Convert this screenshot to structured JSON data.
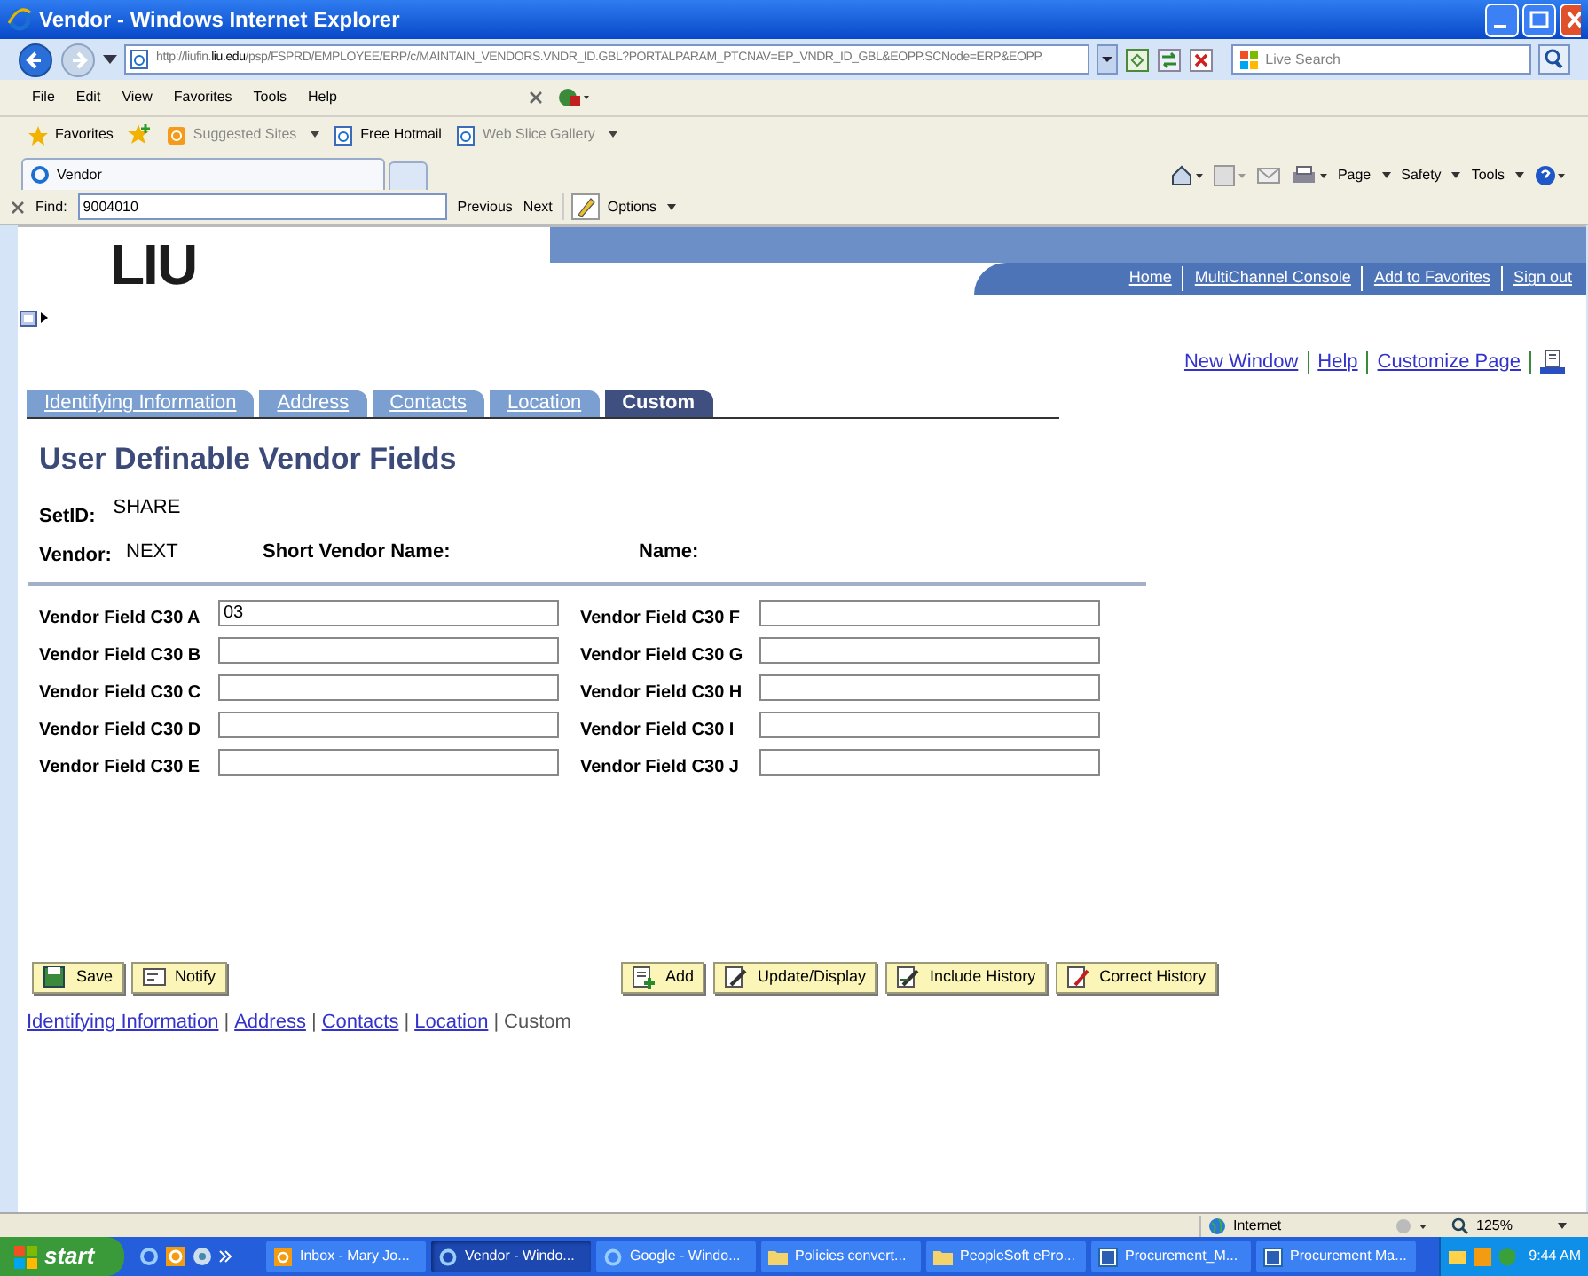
{
  "window": {
    "title": "Vendor - Windows Internet Explorer"
  },
  "address_bar": {
    "url_host": "http://liufin.",
    "url_domain": "liu.edu",
    "url_path": "/psp/FSPRD/EMPLOYEE/ERP/c/MAINTAIN_VENDORS.VNDR_ID.GBL?PORTALPARAM_PTCNAV=EP_VNDR_ID_GBL&EOPP.SCNode=ERP&EOPP."
  },
  "search": {
    "placeholder": "Live Search"
  },
  "menu": [
    "File",
    "Edit",
    "View",
    "Favorites",
    "Tools",
    "Help"
  ],
  "favorites_bar": {
    "favorites": "Favorites",
    "links": [
      "Suggested Sites",
      "Free Hotmail",
      "Web Slice Gallery"
    ]
  },
  "browser_tab": {
    "label": "Vendor"
  },
  "command_bar": [
    "Page",
    "Safety",
    "Tools"
  ],
  "find_bar": {
    "label": "Find:",
    "value": "9004010",
    "buttons": [
      "Previous",
      "Next"
    ],
    "options": "Options"
  },
  "page": {
    "logo": "LIU",
    "header_links": [
      "Home",
      "MultiChannel Console",
      "Add to Favorites",
      "Sign out"
    ],
    "page_links": [
      "New Window",
      "Help",
      "Customize Page"
    ],
    "tabs": [
      {
        "label": "Identifying Information",
        "selected": false
      },
      {
        "label": "Address",
        "selected": false
      },
      {
        "label": "Contacts",
        "selected": false
      },
      {
        "label": "Location",
        "selected": false
      },
      {
        "label": "Custom",
        "selected": true
      }
    ],
    "heading": "User Definable Vendor Fields",
    "setid": {
      "label": "SetID:",
      "value": "SHARE"
    },
    "vendor": {
      "label": "Vendor:",
      "value": "NEXT"
    },
    "short_vendor_name": {
      "label": "Short Vendor Name:"
    },
    "name": {
      "label": "Name:"
    },
    "fields": [
      {
        "label": "Vendor Field C30 A",
        "value": "03"
      },
      {
        "label": "Vendor Field C30 B"
      },
      {
        "label": "Vendor Field C30 C"
      },
      {
        "label": "Vendor Field C30 D"
      },
      {
        "label": "Vendor Field C30 E"
      },
      {
        "label": "Vendor Field C30 F"
      },
      {
        "label": "Vendor Field C30 G"
      },
      {
        "label": "Vendor Field C30 H"
      },
      {
        "label": "Vendor Field C30 I"
      },
      {
        "label": "Vendor Field C30 J"
      }
    ],
    "buttons_left": [
      {
        "label": "Save",
        "kind": "save"
      },
      {
        "label": "Notify",
        "kind": "notify"
      }
    ],
    "buttons_right": [
      {
        "label": "Add",
        "kind": "add"
      },
      {
        "label": "Update/Display",
        "kind": "update"
      },
      {
        "label": "Include History",
        "kind": "history"
      },
      {
        "label": "Correct History",
        "kind": "correct"
      }
    ],
    "footer_links": [
      {
        "label": "Identifying Information",
        "link": true
      },
      {
        "separator": "|",
        "label": "Address",
        "link": true
      },
      {
        "separator": "|",
        "label": "Contacts",
        "link": true
      },
      {
        "separator": "|",
        "label": "Location",
        "link": true
      },
      {
        "separator": "|",
        "label": "Custom",
        "link": false
      }
    ]
  },
  "status_bar": {
    "zone": "Internet",
    "zoom": "125%"
  },
  "taskbar": {
    "start": "start",
    "items": [
      {
        "label": "Inbox - Mary Jo...",
        "selected": false,
        "kind": "outlook"
      },
      {
        "label": "Vendor - Windo...",
        "selected": true,
        "kind": "ie"
      },
      {
        "label": "Google - Windo...",
        "selected": false,
        "kind": "ie"
      },
      {
        "label": "Policies convert...",
        "selected": false,
        "kind": "folder"
      },
      {
        "label": "PeopleSoft ePro...",
        "selected": false,
        "kind": "folder"
      },
      {
        "label": "Procurement_M...",
        "selected": false,
        "kind": "word"
      },
      {
        "label": "Procurement Ma...",
        "selected": false,
        "kind": "word"
      }
    ],
    "clock": "9:44 AM"
  }
}
